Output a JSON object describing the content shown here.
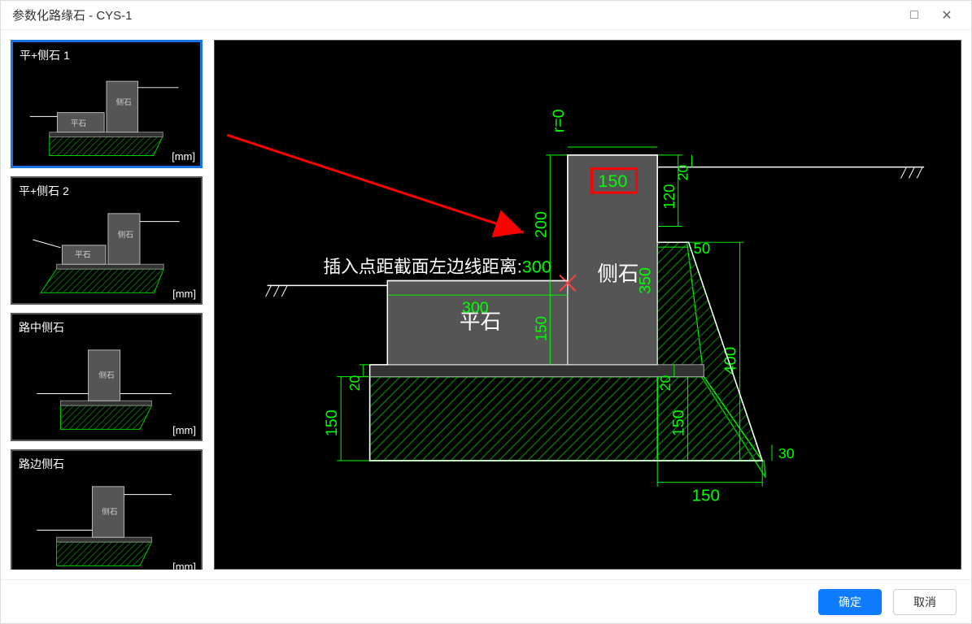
{
  "window": {
    "title": "参数化路缘石 - CYS-1",
    "maximize_icon": "□",
    "close_icon": "✕"
  },
  "thumbs": [
    {
      "label": "平+侧石 1",
      "unit": "[mm]",
      "ce": "侧石",
      "ping": "平石"
    },
    {
      "label": "平+侧石 2",
      "unit": "[mm]",
      "ce": "侧石",
      "ping": "平石"
    },
    {
      "label": "路中侧石",
      "unit": "[mm]",
      "ce": "侧石"
    },
    {
      "label": "路边侧石",
      "unit": "[mm]",
      "ce": "侧石"
    }
  ],
  "main": {
    "insert_label_prefix": "插入点距截面左边线距离:",
    "insert_value": "300",
    "ce_label": "侧石",
    "ping_label": "平石",
    "r_label": "r=0"
  },
  "dims": {
    "v200": "200",
    "v150a": "150",
    "v150d": "150",
    "v150e": "150",
    "v150b": "150",
    "v20a": "20",
    "v20b": "20",
    "v20c": "20",
    "v300": "300",
    "v120": "120",
    "v350": "350",
    "v50": "50",
    "v400": "400",
    "v30": "30",
    "v150c": "150"
  },
  "footer": {
    "ok": "确定",
    "cancel": "取消"
  }
}
